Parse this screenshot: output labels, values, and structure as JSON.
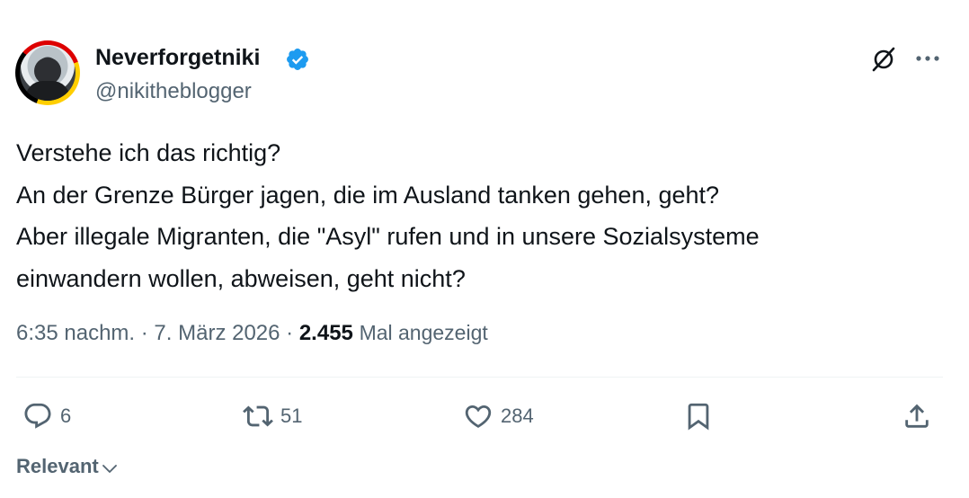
{
  "author": {
    "display_name": "Neverforgetniki",
    "handle": "@nikitheblogger",
    "verified": true
  },
  "tweet": {
    "lines": [
      "Verstehe ich das richtig?",
      "An der Grenze Bürger jagen, die im Ausland tanken gehen, geht?",
      "Aber illegale Migranten, die \"Asyl\" rufen und in unsere Sozialsysteme",
      "einwandern wollen, abweisen, geht nicht?"
    ]
  },
  "meta": {
    "time": "6:35 nachm.",
    "separator": " · ",
    "date": "7. März 2026",
    "views_count": "2.455",
    "views_label": "Mal angezeigt"
  },
  "actions": {
    "replies": "6",
    "reposts": "51",
    "likes": "284"
  },
  "sort": {
    "label": "Relevant"
  },
  "colors": {
    "text": "#0f1419",
    "secondary": "#536471",
    "verified": "#1d9bf0",
    "divider": "#eff3f4"
  },
  "icons": [
    "verified-badge-icon",
    "grok-icon",
    "more-icon",
    "reply-icon",
    "repost-icon",
    "like-icon",
    "bookmark-icon",
    "share-icon",
    "chevron-down-icon"
  ]
}
